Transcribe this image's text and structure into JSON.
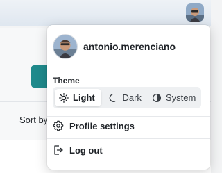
{
  "background": {
    "sort_label": "Sort by:"
  },
  "user": {
    "username": "antonio.merenciano"
  },
  "theme": {
    "label": "Theme",
    "options": [
      {
        "label": "Light",
        "icon": "sun-icon",
        "active": true
      },
      {
        "label": "Dark",
        "icon": "moon-icon",
        "active": false
      },
      {
        "label": "System",
        "icon": "contrast-icon",
        "active": false
      }
    ]
  },
  "menu": {
    "profile_settings": "Profile settings",
    "log_out": "Log out"
  },
  "colors": {
    "accent_teal": "#1f8a8c",
    "menu_bg": "#ffffff",
    "switch_bg": "#eef0f2"
  }
}
